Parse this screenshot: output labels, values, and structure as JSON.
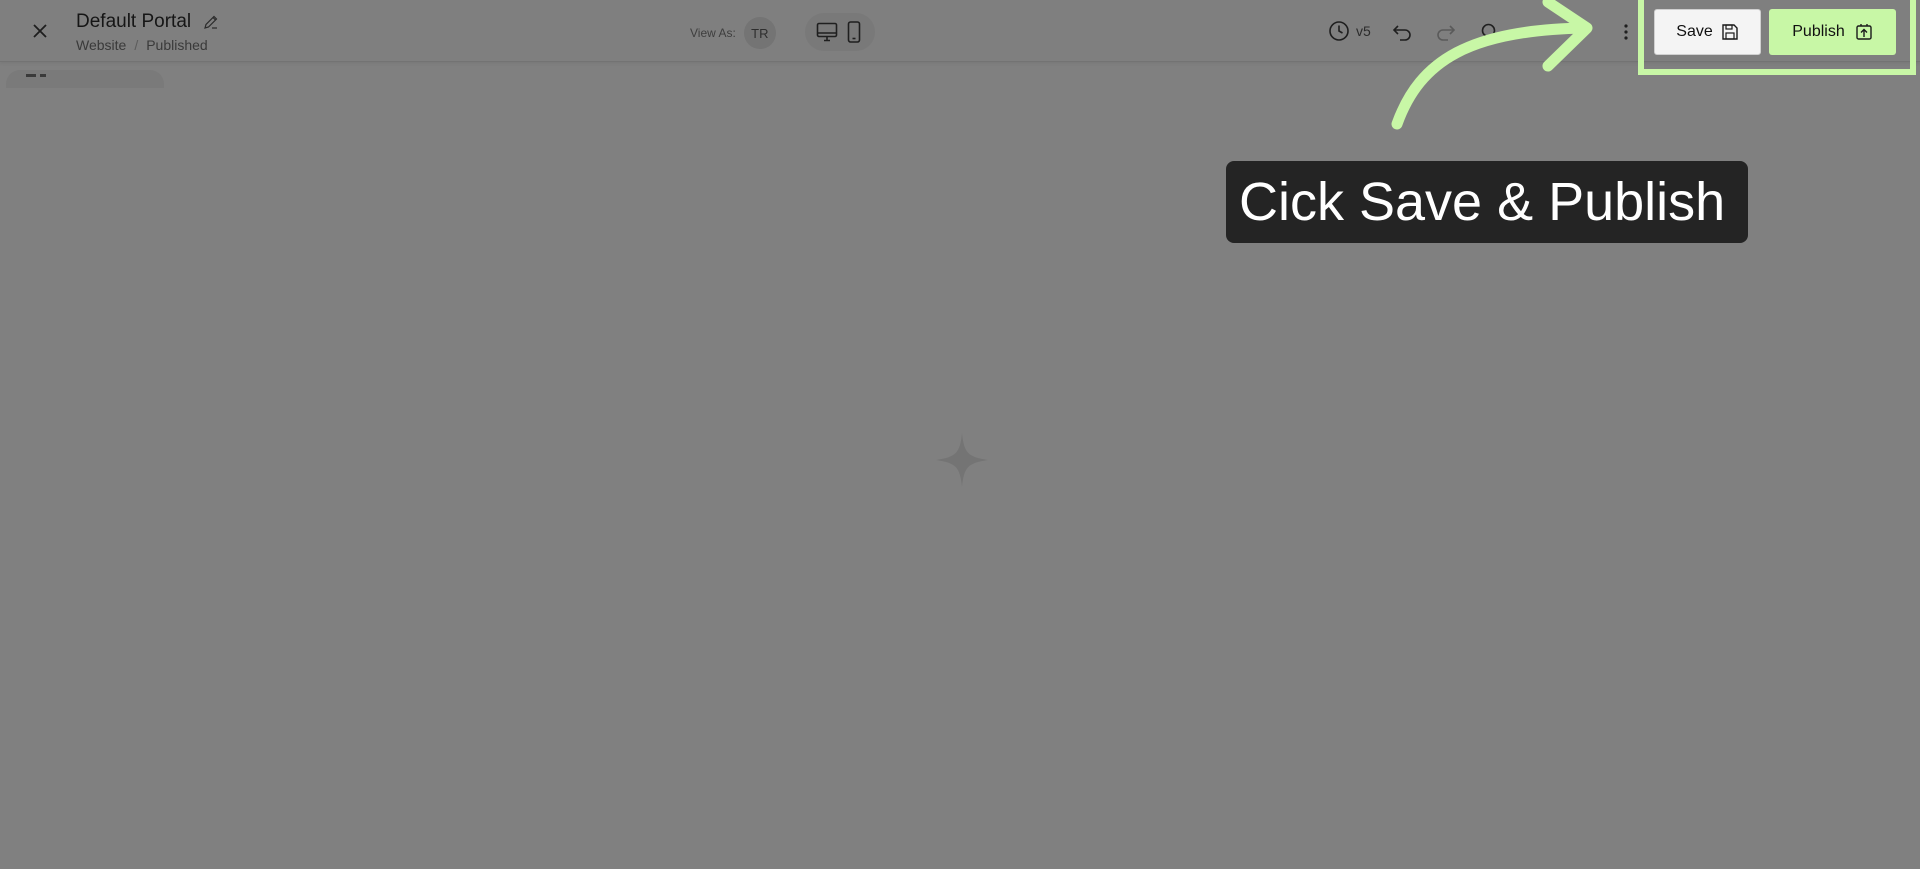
{
  "header": {
    "title": "Default Portal",
    "breadcrumb": [
      "Website",
      "Published"
    ],
    "breadcrumb_separator": "/",
    "view_as_label": "View As:",
    "avatar_initials": "TR",
    "version_label": "v5"
  },
  "actions": {
    "save_label": "Save",
    "publish_label": "Publish"
  },
  "annotation": {
    "callout_text": "Cick Save & Publish"
  },
  "icons": [
    "close-icon",
    "pencil-icon",
    "desktop-icon",
    "mobile-icon",
    "history-icon",
    "undo-icon",
    "redo-icon",
    "search-icon",
    "more-vertical-icon",
    "save-disk-icon",
    "publish-icon",
    "sparkle-icon",
    "curved-arrow-icon"
  ],
  "colors": {
    "overlay": "#808080",
    "highlight": "#c8f7a6",
    "callout_bg": "#242424"
  }
}
